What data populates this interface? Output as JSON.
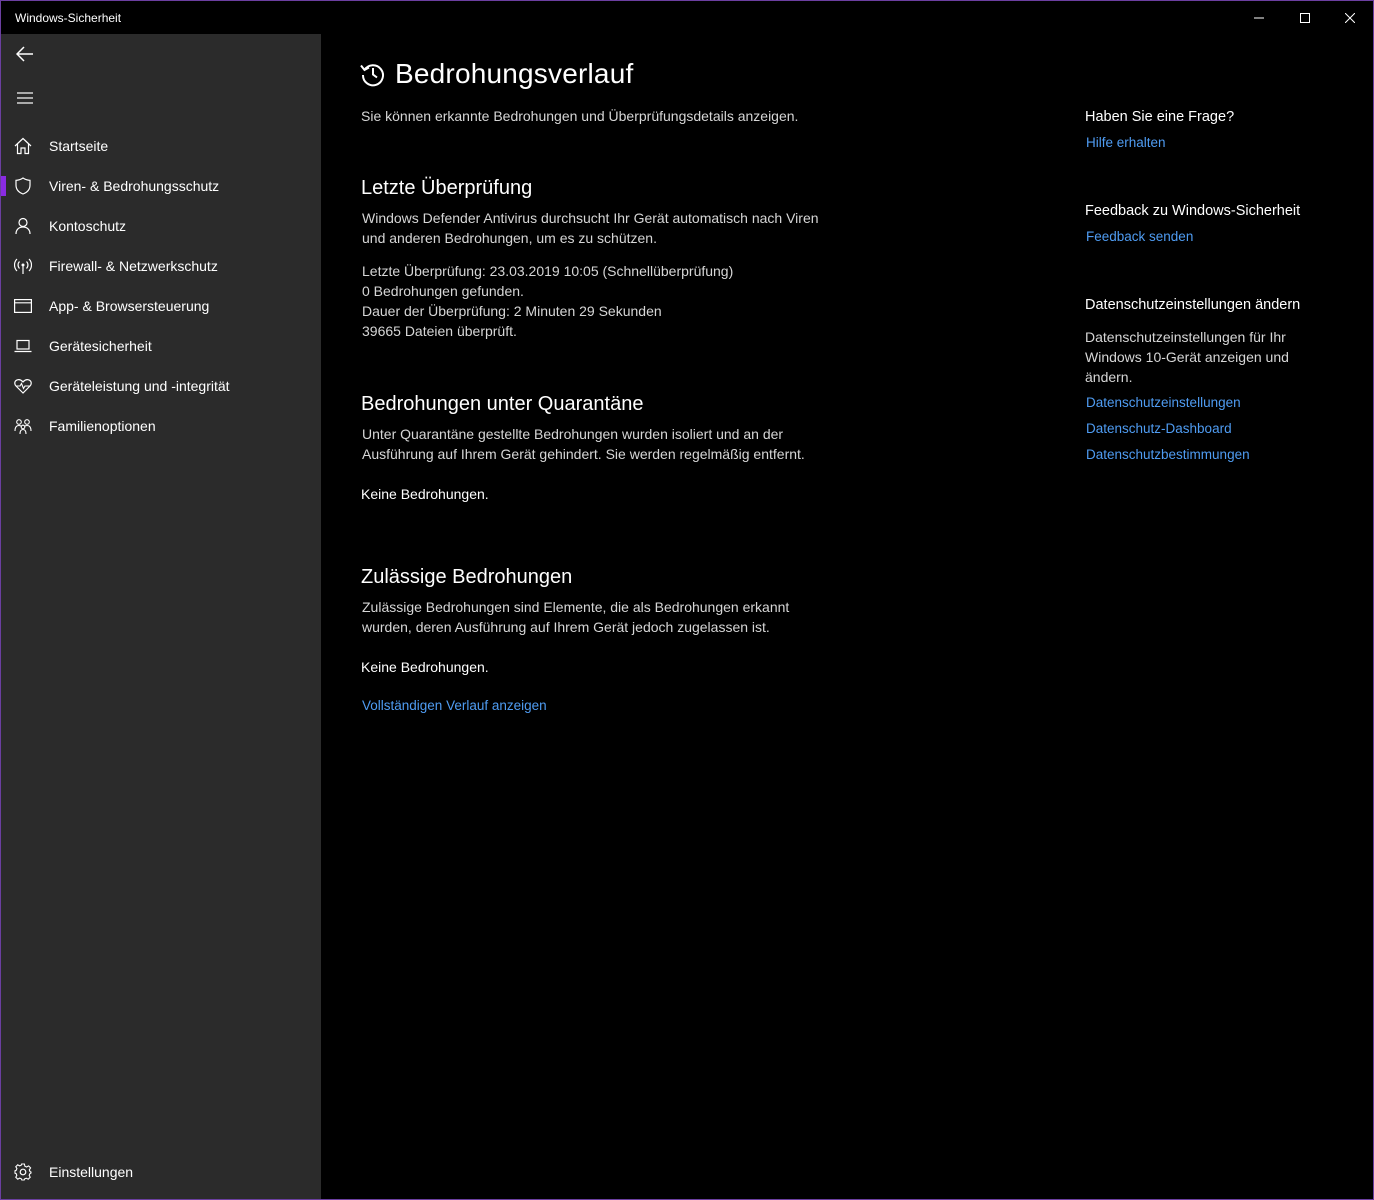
{
  "window": {
    "title": "Windows-Sicherheit"
  },
  "sidebar": {
    "items": [
      {
        "label": "Startseite",
        "icon": "home-icon"
      },
      {
        "label": "Viren- & Bedrohungsschutz",
        "icon": "shield-icon"
      },
      {
        "label": "Kontoschutz",
        "icon": "person-icon"
      },
      {
        "label": "Firewall- & Netzwerkschutz",
        "icon": "antenna-icon"
      },
      {
        "label": "App- & Browsersteuerung",
        "icon": "browser-window-icon"
      },
      {
        "label": "Gerätesicherheit",
        "icon": "laptop-icon"
      },
      {
        "label": "Geräteleistung und -integrität",
        "icon": "heart-pulse-icon"
      },
      {
        "label": "Familienoptionen",
        "icon": "family-icon"
      }
    ],
    "active_index": 1,
    "settings_label": "Einstellungen",
    "accent_color": "#8a2be2"
  },
  "main": {
    "title": "Bedrohungsverlauf",
    "subtitle": "Sie können erkannte Bedrohungen und Überprüfungsdetails anzeigen.",
    "last_scan": {
      "heading": "Letzte Überprüfung",
      "description_line1": "Windows Defender Antivirus durchsucht Ihr Gerät automatisch nach Viren",
      "description_line2": "und anderen Bedrohungen, um es zu schützen.",
      "detail_date": "Letzte Überprüfung: 23.03.2019 10:05 (Schnellüberprüfung)",
      "detail_threats": "0 Bedrohungen gefunden.",
      "detail_duration": "Dauer der Überprüfung: 2 Minuten 29 Sekunden",
      "detail_files": "39665 Dateien überprüft."
    },
    "quarantine": {
      "heading": "Bedrohungen unter Quarantäne",
      "description_line1": "Unter Quarantäne gestellte Bedrohungen wurden isoliert und an der",
      "description_line2": "Ausführung auf Ihrem Gerät gehindert. Sie werden regelmäßig entfernt.",
      "status": "Keine Bedrohungen."
    },
    "allowed": {
      "heading": "Zulässige Bedrohungen",
      "description_line1": "Zulässige Bedrohungen sind Elemente, die als Bedrohungen erkannt",
      "description_line2": "wurden, deren Ausführung auf Ihrem Gerät jedoch zugelassen ist.",
      "status": "Keine Bedrohungen."
    },
    "full_history_link": "Vollständigen Verlauf anzeigen"
  },
  "aside": {
    "question_heading": "Haben Sie eine Frage?",
    "help_link": "Hilfe erhalten",
    "feedback_heading": "Feedback zu Windows-Sicherheit",
    "feedback_link": "Feedback senden",
    "privacy_heading": "Datenschutzeinstellungen ändern",
    "privacy_text_line1": "Datenschutzeinstellungen für Ihr",
    "privacy_text_line2": "Windows 10-Gerät anzeigen und",
    "privacy_text_line3": "ändern.",
    "privacy_links": [
      "Datenschutzeinstellungen",
      "Datenschutz-Dashboard",
      "Datenschutzbestimmungen"
    ],
    "link_color": "#4f9cf2"
  }
}
